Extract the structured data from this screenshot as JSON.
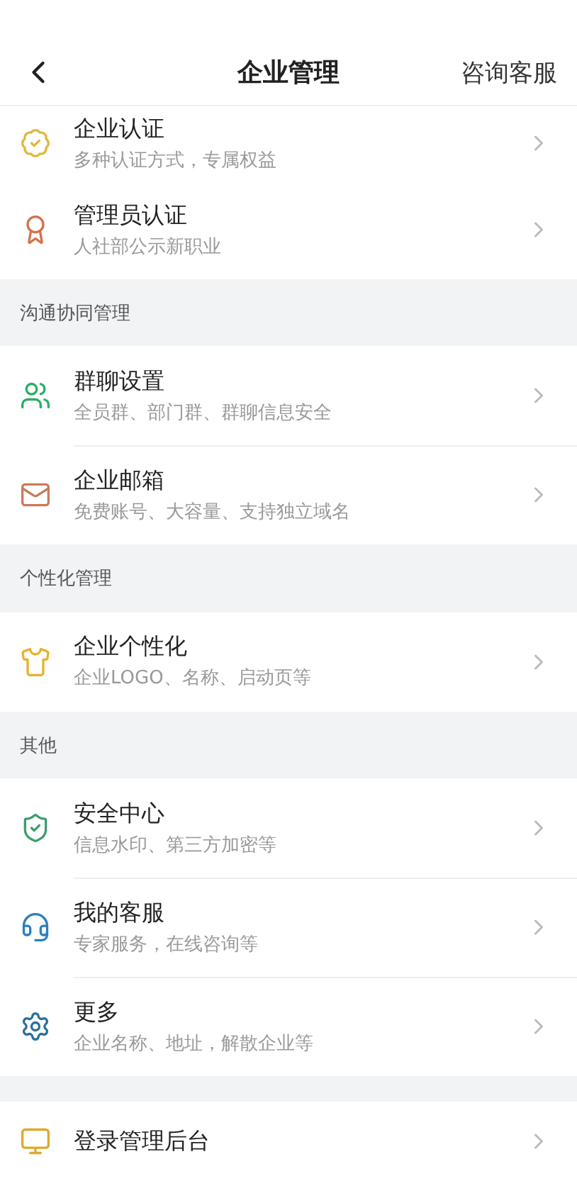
{
  "nav": {
    "title": "企业管理",
    "action": "咨询客服"
  },
  "sections": [
    {
      "items": [
        {
          "title": "企业认证",
          "subtitle": "多种认证方式，专属权益"
        },
        {
          "title": "管理员认证",
          "subtitle": "人社部公示新职业"
        }
      ]
    },
    {
      "title": "沟通协同管理",
      "items": [
        {
          "title": "群聊设置",
          "subtitle": "全员群、部门群、群聊信息安全"
        },
        {
          "title": "企业邮箱",
          "subtitle": "免费账号、大容量、支持独立域名"
        }
      ]
    },
    {
      "title": "个性化管理",
      "items": [
        {
          "title": "企业个性化",
          "subtitle": "企业LOGO、名称、启动页等"
        }
      ]
    },
    {
      "title": "其他",
      "items": [
        {
          "title": "安全中心",
          "subtitle": "信息水印、第三方加密等"
        },
        {
          "title": "我的客服",
          "subtitle": "专家服务，在线咨询等"
        },
        {
          "title": "更多",
          "subtitle": "企业名称、地址，解散企业等"
        }
      ]
    },
    {
      "items": [
        {
          "title": "登录管理后台"
        }
      ]
    }
  ]
}
